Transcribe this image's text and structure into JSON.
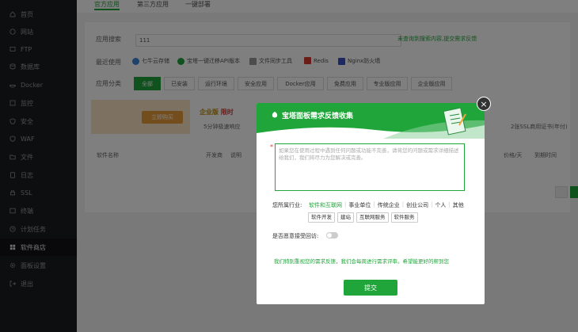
{
  "sidebar": {
    "items": [
      {
        "label": "首页",
        "icon": "home-icon"
      },
      {
        "label": "网站",
        "icon": "globe-icon"
      },
      {
        "label": "FTP",
        "icon": "ftp-icon"
      },
      {
        "label": "数据库",
        "icon": "database-icon"
      },
      {
        "label": "Docker",
        "icon": "docker-icon"
      },
      {
        "label": "监控",
        "icon": "monitor-icon"
      },
      {
        "label": "安全",
        "icon": "shield-icon"
      },
      {
        "label": "WAF",
        "icon": "waf-icon"
      },
      {
        "label": "文件",
        "icon": "folder-icon"
      },
      {
        "label": "日志",
        "icon": "log-icon"
      },
      {
        "label": "SSL",
        "icon": "ssl-icon"
      },
      {
        "label": "终端",
        "icon": "terminal-icon"
      },
      {
        "label": "计划任务",
        "icon": "clock-icon"
      },
      {
        "label": "软件商店",
        "icon": "store-icon",
        "active": true
      },
      {
        "label": "面板设置",
        "icon": "gear-icon"
      },
      {
        "label": "退出",
        "icon": "logout-icon"
      }
    ]
  },
  "tabs": [
    "官方应用",
    "第三方应用",
    "一键部署"
  ],
  "search": {
    "label": "应用搜索",
    "value": "111",
    "link": "未查询到搜索内容,提交需求反馈"
  },
  "recent": {
    "label": "最近使用",
    "items": [
      "七牛云存储",
      "宝塔一键迁移API版本",
      "文件同步工具",
      "Redis",
      "Nginx防火墙"
    ]
  },
  "categories": {
    "label": "应用分类",
    "items": [
      "全部",
      "已安装",
      "运行环境",
      "安全应用",
      "Docker应用",
      "免费应用",
      "专业版应用",
      "企业版应用"
    ]
  },
  "promo": {
    "button": "立即购买",
    "edition": "企业版",
    "limited": "限时",
    "feature": "5分钟极速响应"
  },
  "ssl_text": "2张SSL商用证书(年付)",
  "table_headers": [
    "软件名称",
    "开发商",
    "说明",
    "价格/天",
    "到期时间"
  ],
  "modal": {
    "title": "宝塔面板需求反馈收集",
    "textarea_placeholder": "如果您在使用过程中遇到任何问题或功能不完善，请将您的问题或需求详细描述给我们，我们将尽力为您解决或完善。",
    "industry_label": "您所属行业:",
    "industry_options": [
      "软件和互联网",
      "事业单位",
      "传统企业",
      "创业公司",
      "个人",
      "其他"
    ],
    "industry_selected": "软件和互联网",
    "sub_options": [
      "软件开发",
      "建站",
      "互联网服务",
      "软件服务"
    ],
    "callback_label": "是否愿意接受回访:",
    "note": "我们特别重视您的需求反馈，我们会每周进行需求评审。希望能更好的帮到您",
    "submit": "提交"
  },
  "colors": {
    "accent": "#20a53a",
    "sidebar_bg": "#1b1d21"
  }
}
